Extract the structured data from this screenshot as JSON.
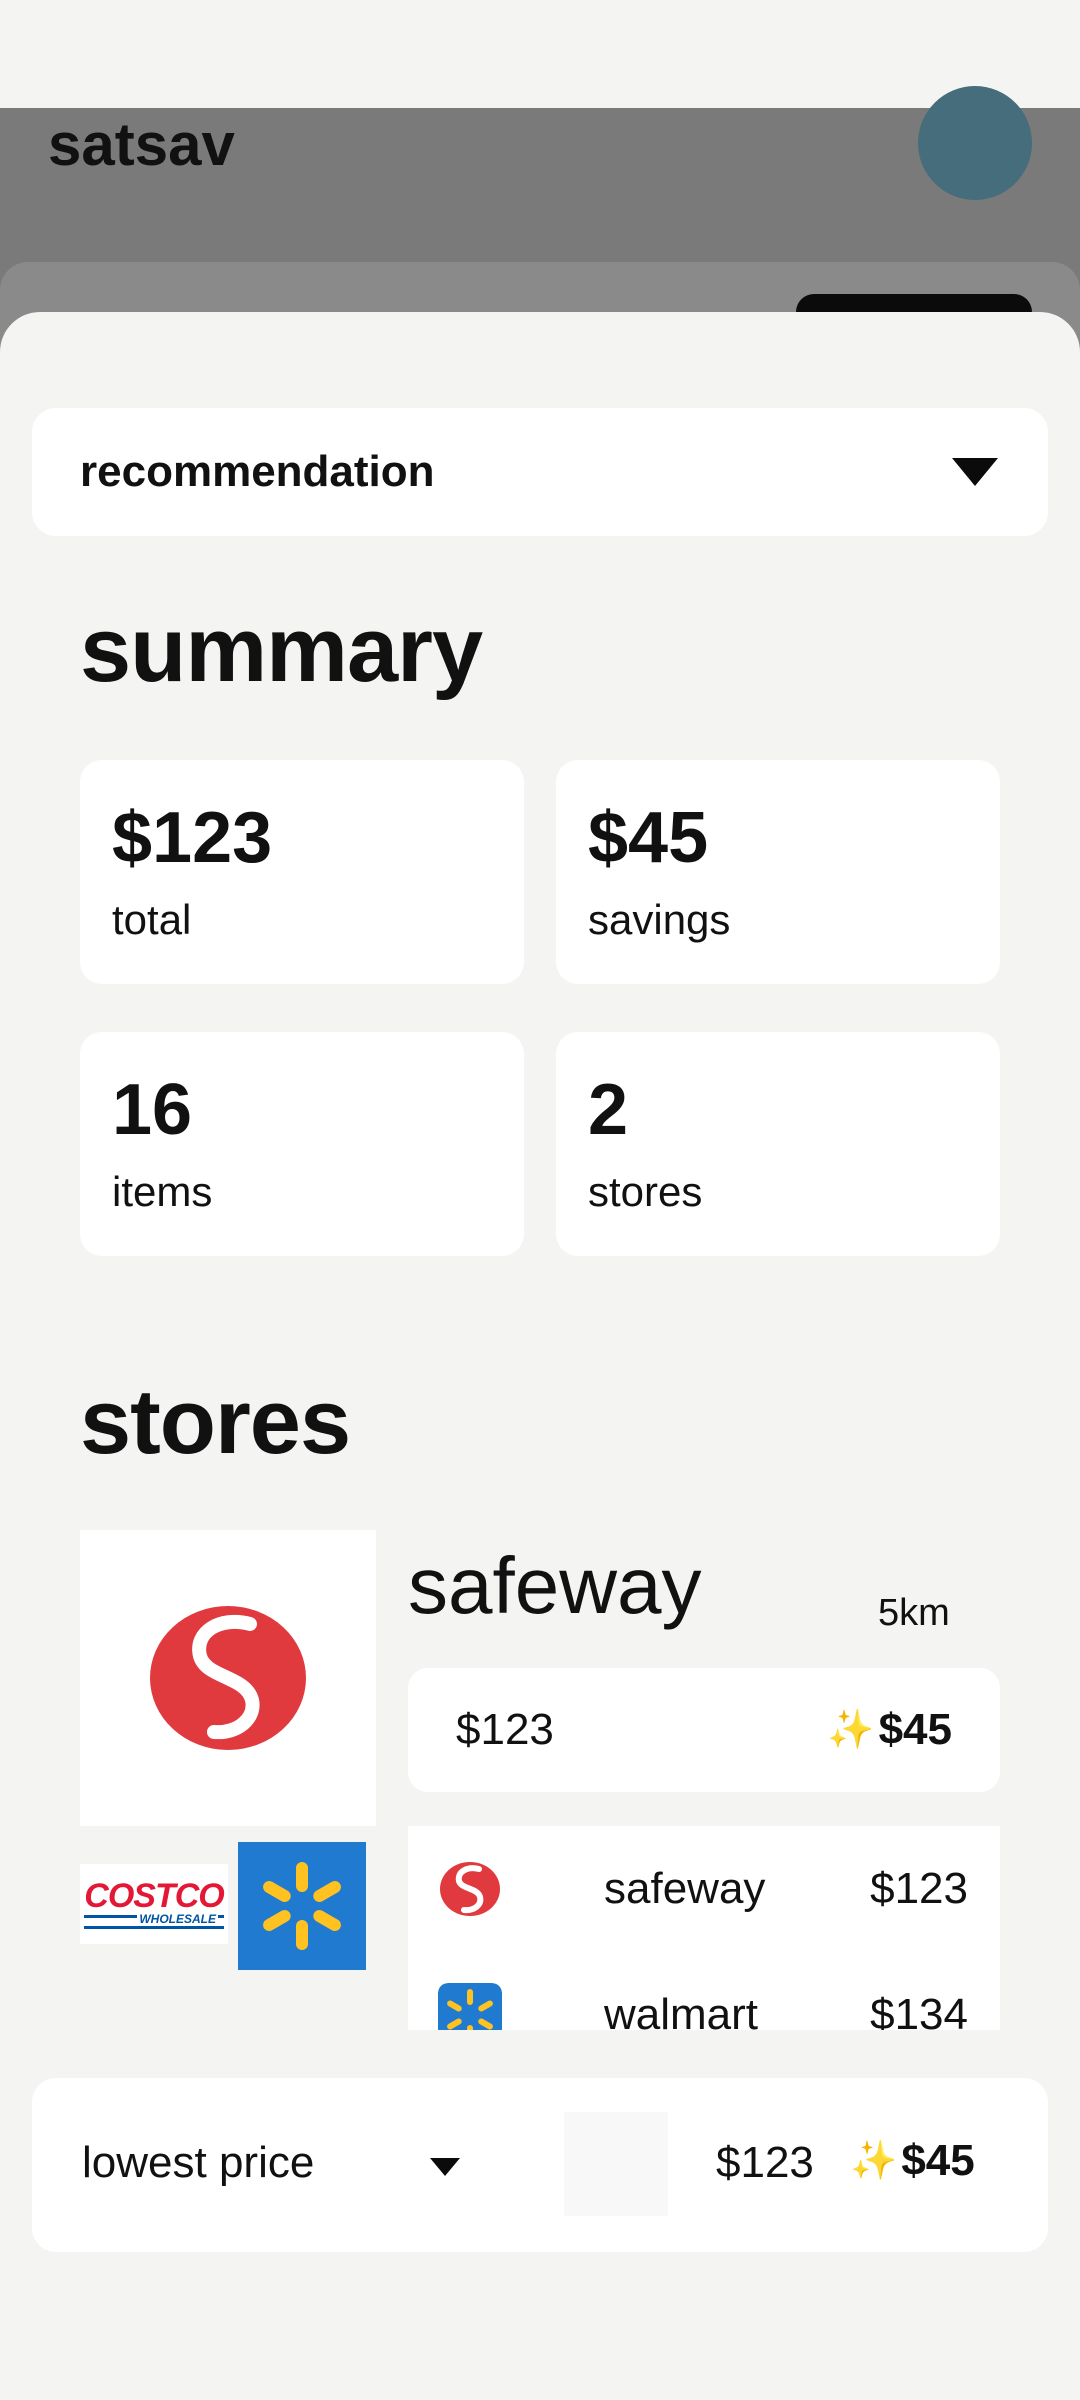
{
  "header": {
    "app_title": "satsav"
  },
  "sheet": {
    "dropdown": {
      "label": "recommendation",
      "icon": "caret-down-icon"
    },
    "summary": {
      "title": "summary",
      "cards": [
        {
          "value": "$123",
          "label": "total"
        },
        {
          "value": "$45",
          "label": "savings"
        },
        {
          "value": "16",
          "label": "items"
        },
        {
          "value": "2",
          "label": "stores"
        }
      ]
    },
    "stores": {
      "title": "stores",
      "selected": {
        "name": "safeway",
        "distance": "5km",
        "price": "$123",
        "savings": "$45",
        "savings_icon": "sparkles-icon"
      },
      "list": [
        {
          "name": "safeway",
          "price": "$123",
          "logo": "safeway-logo"
        },
        {
          "name": "walmart",
          "price": "$134",
          "logo": "walmart-logo"
        }
      ],
      "other_logos": [
        "costco-logo",
        "walmart-logo"
      ],
      "costco_wordmark": "COSTCO",
      "costco_subtitle": "WHOLESALE"
    }
  },
  "bottom_bar": {
    "sort_label": "lowest price",
    "price": "$123",
    "savings": "$45"
  },
  "colors": {
    "safeway_red": "#e03a3e",
    "walmart_blue": "#1f7ad0",
    "walmart_yellow": "#ffc220",
    "avatar": "#456d7c"
  }
}
